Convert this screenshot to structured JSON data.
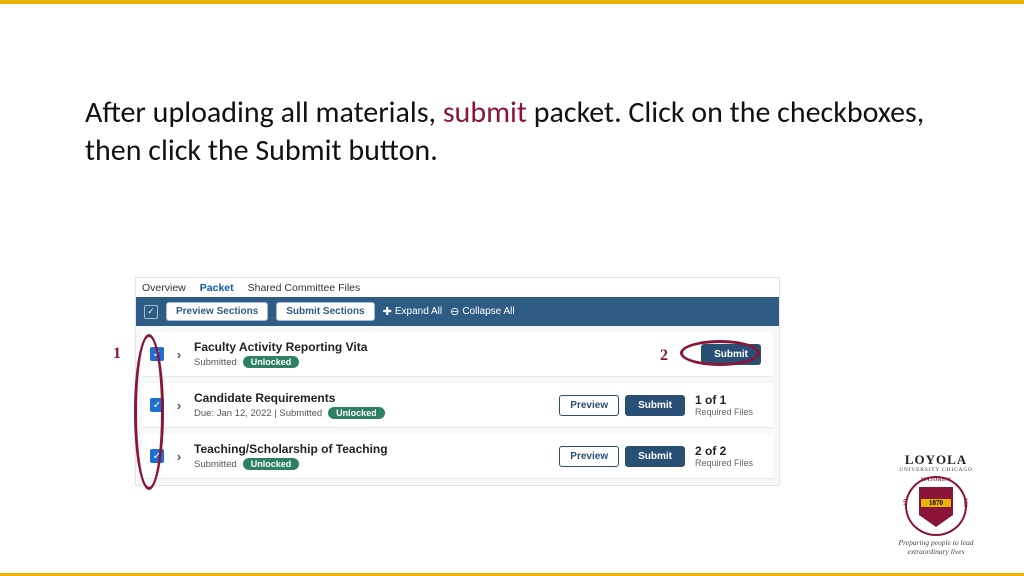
{
  "instruction": {
    "part1": "After uploading all materials, ",
    "highlight": "submit",
    "part2": " packet. Click on the checkboxes, then click the Submit button."
  },
  "annotations": {
    "one": "1",
    "two": "2"
  },
  "tabs": {
    "overview": "Overview",
    "packet": "Packet",
    "shared": "Shared Committee Files"
  },
  "toolbar": {
    "preview": "Preview Sections",
    "submit": "Submit Sections",
    "expand": "Expand All",
    "collapse": "Collapse All"
  },
  "rows": [
    {
      "title": "Faculty Activity Reporting Vita",
      "status": "Submitted",
      "badge": "Unlocked",
      "preview": "",
      "submit": "Submit",
      "count": "",
      "countLabel": ""
    },
    {
      "title": "Candidate Requirements",
      "status": "Due: Jan 12, 2022 |  Submitted",
      "badge": "Unlocked",
      "preview": "Preview",
      "submit": "Submit",
      "count": "1 of 1",
      "countLabel": "Required Files"
    },
    {
      "title": "Teaching/Scholarship of Teaching",
      "status": "Submitted",
      "badge": "Unlocked",
      "preview": "Preview",
      "submit": "Submit",
      "count": "2 of 2",
      "countLabel": "Required Files"
    }
  ],
  "logo": {
    "name": "LOYOLA",
    "sub": "UNIVERSITY CHICAGO",
    "year": "1870",
    "ring_top": "MAJOREM",
    "ring_left": "AD",
    "ring_right": "DEI",
    "motto": "Preparing people to lead extraordinary lives"
  }
}
